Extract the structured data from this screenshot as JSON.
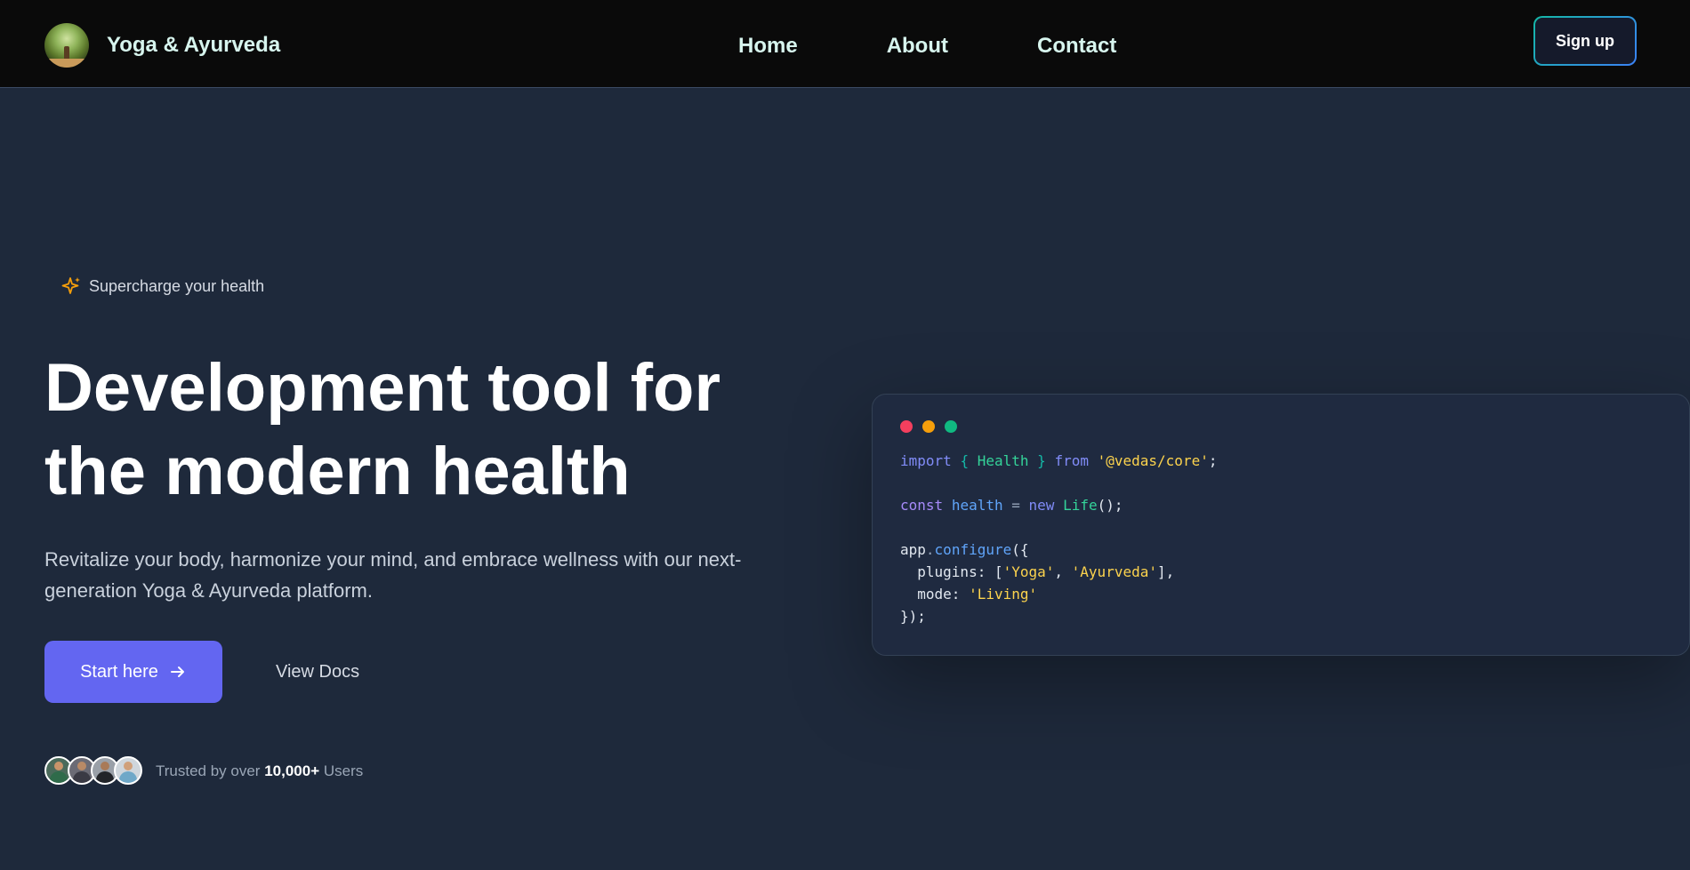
{
  "navbar": {
    "brand_name": "Yoga & Ayurveda",
    "links": [
      "Home",
      "About",
      "Contact"
    ],
    "signup_label": "Sign up"
  },
  "hero": {
    "badge_text": "Supercharge your health",
    "headline_line1": "Development tool for",
    "headline_line2": "the modern health",
    "subtext": "Revitalize your body, harmonize your mind, and embrace wellness with our next-generation Yoga & Ayurveda platform.",
    "primary_button": "Start here",
    "secondary_link": "View Docs",
    "trusted_prefix": "Trusted by over",
    "trusted_count": "10,000+",
    "trusted_suffix": "Users"
  },
  "code": {
    "import_kw": "import",
    "open_brace": "{",
    "import_name": "Health",
    "close_brace": "}",
    "from_kw": "from",
    "module": "'@vedas/core'",
    "semicolon": ";",
    "const_kw": "const",
    "var_name": "health",
    "equals": "=",
    "new_kw": "new",
    "class_name": "Life",
    "call_end": "();",
    "obj": "app",
    "dot": ".",
    "method": "configure",
    "open_call": "({",
    "plugins_key": "plugins: [",
    "plugin1": "'Yoga'",
    "comma": ", ",
    "plugin2": "'Ayurveda'",
    "plugins_end": "],",
    "mode_key": "mode: ",
    "mode_value": "'Living'",
    "close_call": "});"
  },
  "icons": {
    "sparkle": "sparkle-icon",
    "arrow": "arrow-right-icon"
  },
  "colors": {
    "accent": "#6366f1",
    "background": "#1e293b",
    "navbar": "#0a0a0a",
    "dot_red": "#f43f5e",
    "dot_amber": "#f59e0b",
    "dot_green": "#10b981"
  }
}
